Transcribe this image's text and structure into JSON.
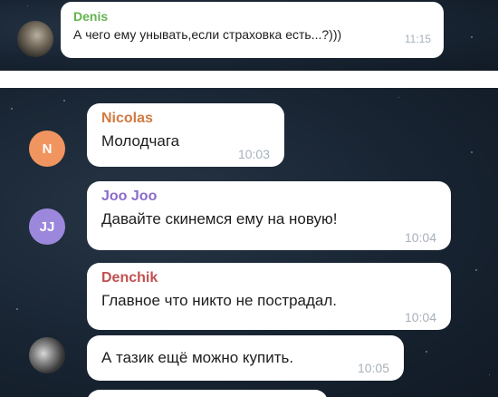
{
  "top_message": {
    "sender": "Denis",
    "sender_color": "#62b34c",
    "text": "А чего ему унывать,если страховка есть...?)))",
    "time": "11:15"
  },
  "messages": [
    {
      "sender": "Nicolas",
      "sender_color": "#d27a42",
      "avatar_letter": "N",
      "avatar_color": "#f0955f",
      "text": "Молодчага",
      "time": "10:03"
    },
    {
      "sender": "Joo Joo",
      "sender_color": "#8a6cc9",
      "avatar_letter": "JJ",
      "avatar_color": "#9b88dc",
      "text": "Давайте скинемся ему на новую!",
      "time": "10:04"
    },
    {
      "sender": "Denchik",
      "sender_color": "#c35050",
      "text": "Главное что никто не пострадал.",
      "time": "10:04"
    },
    {
      "text": "А тазик ещё можно купить.",
      "time": "10:05"
    }
  ]
}
